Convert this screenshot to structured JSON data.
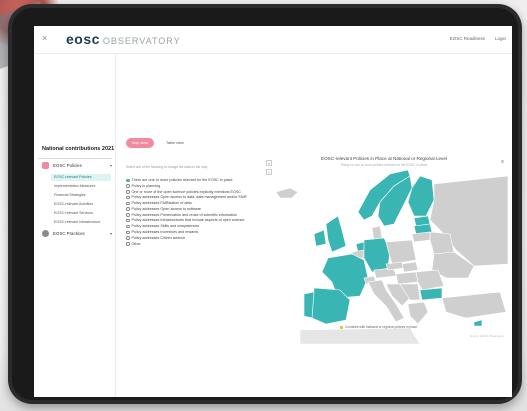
{
  "header": {
    "close_symbol": "×",
    "logo_primary": "eosc",
    "logo_secondary": "OBSERVATORY",
    "links": [
      "EOSC Readiness",
      "Login"
    ]
  },
  "sidebar": {
    "title": "National contributions 2021",
    "categories": [
      {
        "label": "EOSC Policies",
        "icon": "policy-icon",
        "color": "#f08aa0",
        "expanded": true
      },
      {
        "label": "EOSC Practices",
        "icon": "practice-icon",
        "color": "#8a8a8a",
        "expanded": false
      }
    ],
    "items": [
      {
        "label": "EOSC-relevant Policies",
        "active": true
      },
      {
        "label": "Implementation Measures",
        "active": false
      },
      {
        "label": "Financial Strategies",
        "active": false
      },
      {
        "label": "EOSC-relevant Activities",
        "active": false
      },
      {
        "label": "EOSC-relevant Services",
        "active": false
      },
      {
        "label": "EOSC-relevant Infrastructure",
        "active": false
      }
    ]
  },
  "main": {
    "view_buttons": {
      "map": "Map view",
      "table": "Table view"
    },
    "instructions": "Select one of the following to change the data on the map",
    "options": [
      {
        "label": "There are one or more policies relevant for the EOSC in place",
        "selected": true
      },
      {
        "label": "Policy in planning",
        "selected": false
      },
      {
        "label": "One or more of the open science policies explicitly mentions EOSC",
        "selected": false
      },
      {
        "label": "Policy addresses Open access to data, data management and/or FAIR",
        "selected": false
      },
      {
        "label": "Policy addresses FAIRisation of data",
        "selected": false
      },
      {
        "label": "Policy addresses Open access to software",
        "selected": false
      },
      {
        "label": "Policy addresses Preservation and reuse of scientific information",
        "selected": false
      },
      {
        "label": "Policy addresses Infrastructures that include aspects of open science",
        "selected": false
      },
      {
        "label": "Policy addresses Skills and competences",
        "selected": false
      },
      {
        "label": "Policy addresses Incentives and rewards",
        "selected": false
      },
      {
        "label": "Policy addresses Citizen science",
        "selected": false
      },
      {
        "label": "Other",
        "selected": false
      }
    ],
    "map": {
      "title": "EOSC-relevant Policies in Place at National or Regional Level",
      "subtitle": "Policy on one or more policies relevant for the EOSC in place",
      "zoom_in": "+",
      "zoom_out": "−",
      "menu_symbol": "≡",
      "legend": "Countries with National or regional policies in place",
      "credit": "Source: EOSC Observatory",
      "colors": {
        "policy": "#39b6b3",
        "no_data": "#cfcfcf",
        "outline": "#ffffff"
      }
    }
  }
}
